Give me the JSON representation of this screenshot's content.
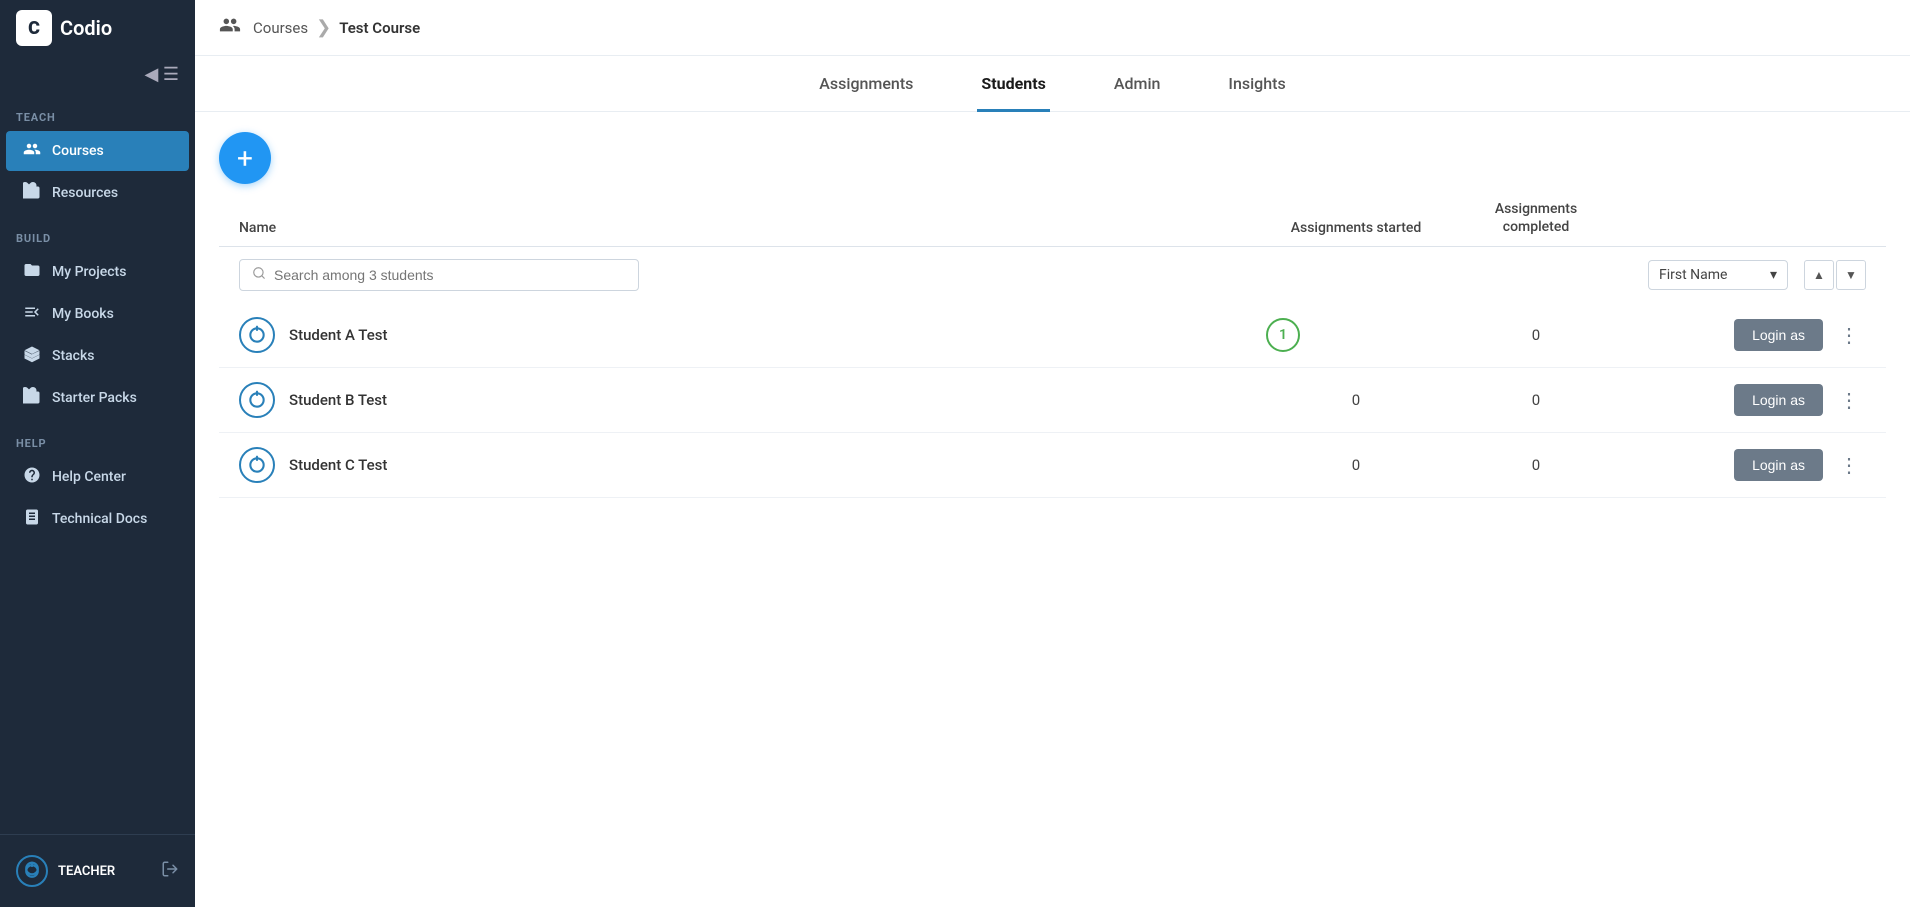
{
  "app": {
    "name": "Codio"
  },
  "sidebar": {
    "toggle_label": "≡",
    "sections": [
      {
        "label": "TEACH",
        "items": [
          {
            "id": "courses",
            "label": "Courses",
            "icon": "👤",
            "active": true
          },
          {
            "id": "resources",
            "label": "Resources",
            "icon": "📄",
            "active": false
          }
        ]
      },
      {
        "label": "BUILD",
        "items": [
          {
            "id": "my-projects",
            "label": "My Projects",
            "icon": "📁",
            "active": false
          },
          {
            "id": "my-books",
            "label": "My Books",
            "icon": "📝",
            "active": false
          },
          {
            "id": "stacks",
            "label": "Stacks",
            "icon": "📦",
            "active": false
          },
          {
            "id": "starter-packs",
            "label": "Starter Packs",
            "icon": "🎁",
            "active": false
          }
        ]
      },
      {
        "label": "HELP",
        "items": [
          {
            "id": "help-center",
            "label": "Help Center",
            "icon": "❓",
            "active": false
          },
          {
            "id": "technical-docs",
            "label": "Technical Docs",
            "icon": "📖",
            "active": false
          }
        ]
      }
    ],
    "user": {
      "name": "TEACHER",
      "role": "teacher"
    }
  },
  "breadcrumb": {
    "courses_label": "Courses",
    "separator": "❯",
    "current": "Test Course"
  },
  "tabs": [
    {
      "id": "assignments",
      "label": "Assignments",
      "active": false
    },
    {
      "id": "students",
      "label": "Students",
      "active": true
    },
    {
      "id": "admin",
      "label": "Admin",
      "active": false
    },
    {
      "id": "insights",
      "label": "Insights",
      "active": false
    }
  ],
  "add_button_label": "+",
  "table": {
    "columns": {
      "name": "Name",
      "assignments_started": "Assignments started",
      "assignments_completed": "Assignments\ncompleted"
    },
    "search_placeholder": "Search among 3 students",
    "sort_label": "First Name",
    "students": [
      {
        "id": "student-a",
        "name": "Student A Test",
        "assignments_started": "1",
        "assignments_started_badge": true,
        "assignments_completed": "0",
        "login_label": "Login as"
      },
      {
        "id": "student-b",
        "name": "Student B Test",
        "assignments_started": "0",
        "assignments_started_badge": false,
        "assignments_completed": "0",
        "login_label": "Login as"
      },
      {
        "id": "student-c",
        "name": "Student C Test",
        "assignments_started": "0",
        "assignments_started_badge": false,
        "assignments_completed": "0",
        "login_label": "Login as"
      }
    ]
  }
}
